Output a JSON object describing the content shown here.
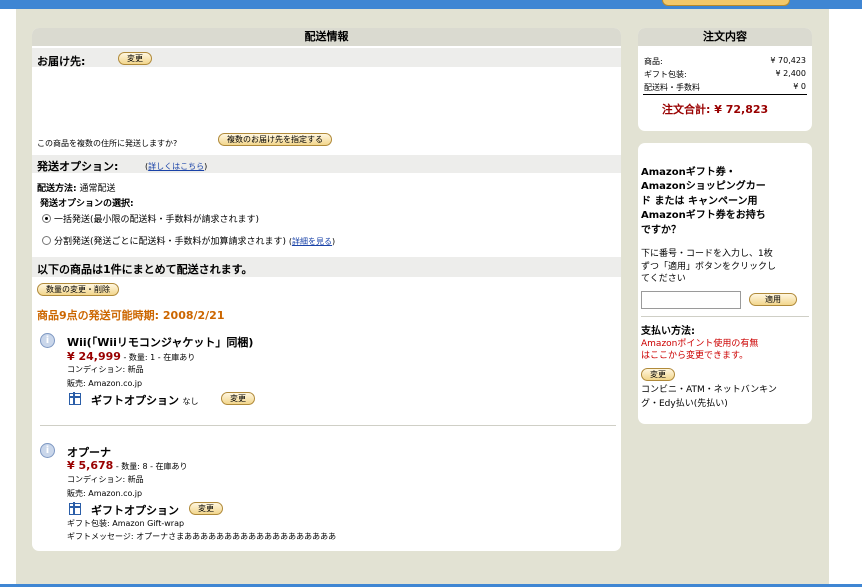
{
  "shipping": {
    "header": "配送情報",
    "deliver_to_label": "お届け先:",
    "change_button": "変更",
    "multi_address_question": "この商品を複数の住所に発送しますか?",
    "multi_address_button": "複数のお届け先を指定する",
    "options_label": "発送オプション:",
    "options_link": "詳しくはこちら",
    "method_label": "配送方法:",
    "method_value": "通常配送",
    "select_label": "発送オプションの選択:",
    "option_single": "一括発送(最小限の配送料・手数料が請求されます)",
    "option_split": "分割発送(発送ごとに配送料・手数料が加算請求されます)",
    "option_split_link": "詳細を見る",
    "summary": "以下の商品は1件にまとめて配送されます。",
    "qty_button": "数量の変更・削除",
    "ship_date": "商品9点の発送可能時期: 2008/2/21"
  },
  "items": [
    {
      "title": "Wii(「Wiiリモコンジャケット」同梱)",
      "price": "¥ 24,999",
      "qty": " - 数量: 1 - 在庫あり",
      "condition": "コンディション: 新品",
      "seller": "販売: Amazon.co.jp",
      "gift_label": "ギフトオプション",
      "gift_value": "なし",
      "gift_button": "変更"
    },
    {
      "title": "オプーナ",
      "price": "¥ 5,678",
      "qty": " - 数量: 8 - 在庫あり",
      "condition": "コンディション: 新品",
      "seller": "販売: Amazon.co.jp",
      "gift_label": "ギフトオプション",
      "gift_button": "変更",
      "gift_wrap": "ギフト包装: Amazon Gift-wrap",
      "gift_message": "ギフトメッセージ: オプーナさまあああああああああああああああああああ"
    }
  ],
  "order": {
    "header": "注文内容",
    "items_label": "商品:",
    "items_value": "¥ 70,423",
    "wrap_label": "ギフト包装:",
    "wrap_value": "¥ 2,400",
    "shipping_label": "配送料・手数料",
    "shipping_value": "¥ 0",
    "total": "注文合計: ¥ 72,823"
  },
  "gift_card": {
    "title_lines": [
      "Amazonギフト券・",
      "Amazonショッピングカー",
      "ド または キャンペーン用",
      "Amazonギフト券をお持ち",
      "ですか？"
    ],
    "desc_lines": [
      "下に番号・コードを入力し、1枚",
      "ずつ「適用」ボタンをクリックし",
      "てください"
    ],
    "apply_button": "適用"
  },
  "payment": {
    "label": "支払い方法:",
    "notice_lines": [
      "Amazonポイント使用の有無",
      "はここから変更できます。"
    ],
    "change_button": "変更",
    "method_lines": [
      "コンビニ・ATM・ネットバンキン",
      "グ・Edy払い(先払い)"
    ]
  },
  "colors": {
    "accent_blue": "#3f86d3",
    "price_red": "#990000",
    "ship_date_orange": "#cc6600",
    "link_blue": "#1a43a8"
  }
}
